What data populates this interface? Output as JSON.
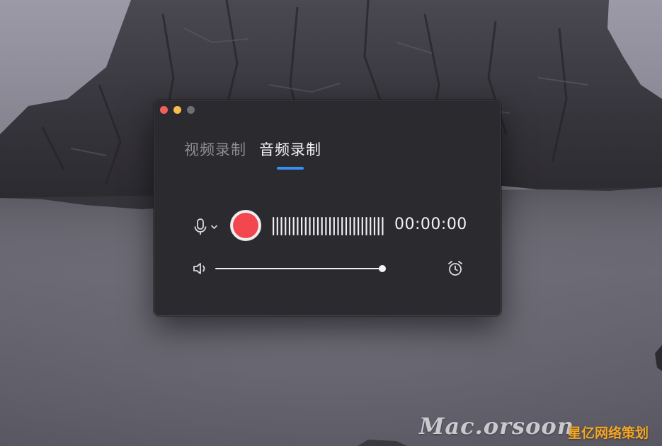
{
  "tabs": [
    {
      "label": "视频录制",
      "active": false
    },
    {
      "label": "音频录制",
      "active": true
    }
  ],
  "recorder": {
    "timer": "00:00:00",
    "input_icon": "microphone-icon",
    "dropdown_icon": "chevron-down-icon",
    "record_icon": "record-button",
    "volume_icon": "speaker-icon",
    "schedule_icon": "alarm-clock-icon",
    "volume_level": 1.0,
    "level_bars": 28
  },
  "watermark": {
    "text": "Mac.orsoon",
    "overlay": "星亿网络策划"
  },
  "colors": {
    "window_bg": "#2b2b2f",
    "accent": "#3a8ef2",
    "record": "#f2474f",
    "close": "#f0605b",
    "minimize": "#f6be4f",
    "inactive": "#6f6f73"
  }
}
